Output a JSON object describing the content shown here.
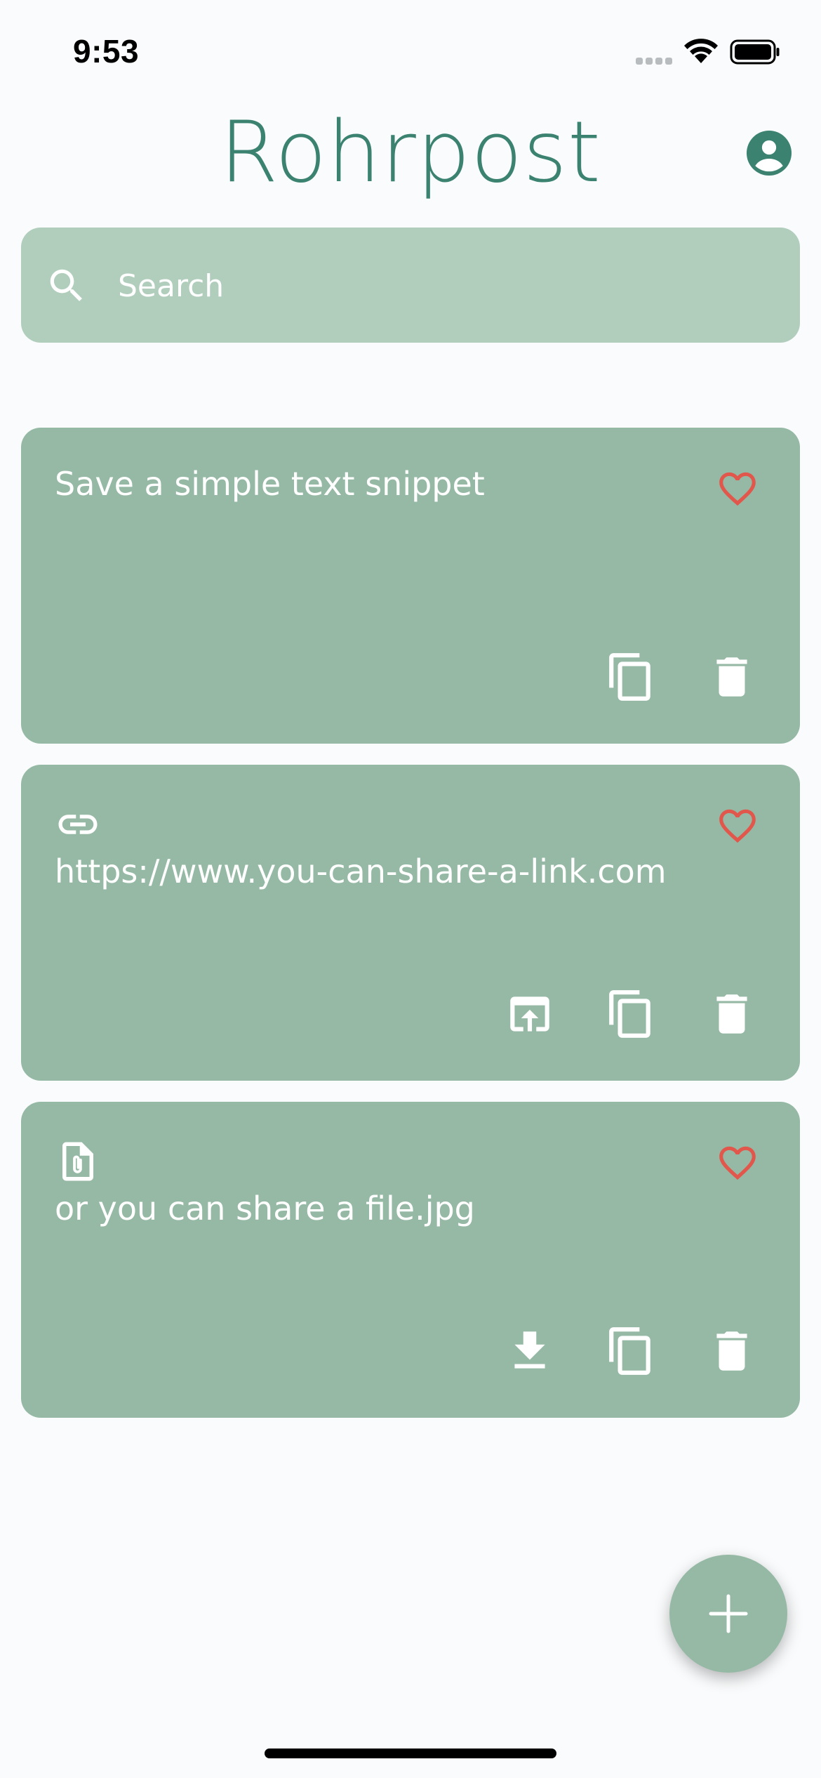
{
  "status_bar": {
    "time": "9:53"
  },
  "header": {
    "title": "Rohrpost",
    "profile_icon": "account-circle-icon"
  },
  "search": {
    "placeholder": "Search",
    "icon": "search-icon"
  },
  "colors": {
    "accent": "#3b8271",
    "search_bg": "#b1cebd",
    "card_bg": "#95b9a4",
    "favorite": "#e2574c",
    "background": "#f9fbfc"
  },
  "items": [
    {
      "type": "text",
      "content": "Save a simple text snippet",
      "favorite": false,
      "actions": [
        "copy-icon",
        "delete-icon"
      ]
    },
    {
      "type": "link",
      "type_icon": "link-icon",
      "content": "https://www.you-can-share-a-link.com",
      "favorite": false,
      "actions": [
        "open-in-browser-icon",
        "copy-icon",
        "delete-icon"
      ]
    },
    {
      "type": "file",
      "type_icon": "file-attachment-icon",
      "content": "or you can share a file.jpg",
      "favorite": false,
      "actions": [
        "download-icon",
        "copy-icon",
        "delete-icon"
      ]
    }
  ],
  "fab": {
    "icon": "plus-icon"
  }
}
